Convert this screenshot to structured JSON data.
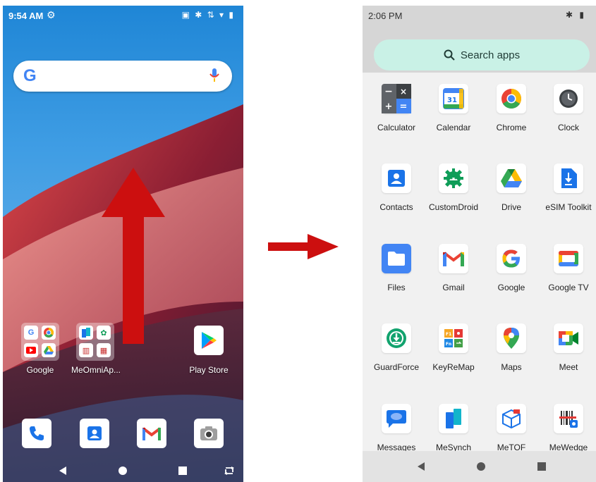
{
  "home": {
    "status_time": "9:54 AM",
    "status_icons": "▣ ✱ ⇅ ▾ ▮",
    "search_logo": "G",
    "folders": [
      {
        "label": "Google"
      },
      {
        "label": "MeOmniAp..."
      }
    ],
    "play_store_label": "Play Store",
    "dock": [
      "phone-icon",
      "contacts-icon",
      "gmail-icon",
      "camera-icon"
    ],
    "swipe_arrow_color": "#cc0f0f"
  },
  "drawer": {
    "status_time": "2:06 PM",
    "status_icons": "✱ ▮",
    "search_placeholder": "Search apps",
    "apps": [
      {
        "label": "Calculator",
        "icon": "calculator-icon"
      },
      {
        "label": "Calendar",
        "icon": "calendar-icon"
      },
      {
        "label": "Chrome",
        "icon": "chrome-icon"
      },
      {
        "label": "Clock",
        "icon": "clock-icon"
      },
      {
        "label": "Contacts",
        "icon": "contacts-icon"
      },
      {
        "label": "CustomDroid",
        "icon": "customdroid-icon"
      },
      {
        "label": "Drive",
        "icon": "drive-icon"
      },
      {
        "label": "eSIM Toolkit",
        "icon": "esim-toolkit-icon"
      },
      {
        "label": "Files",
        "icon": "files-icon"
      },
      {
        "label": "Gmail",
        "icon": "gmail-icon"
      },
      {
        "label": "Google",
        "icon": "google-icon"
      },
      {
        "label": "Google TV",
        "icon": "google-tv-icon"
      },
      {
        "label": "GuardForce",
        "icon": "guardforce-icon"
      },
      {
        "label": "KeyReMap",
        "icon": "keyremap-icon"
      },
      {
        "label": "Maps",
        "icon": "maps-icon"
      },
      {
        "label": "Meet",
        "icon": "meet-icon"
      },
      {
        "label": "Messages",
        "icon": "messages-icon"
      },
      {
        "label": "MeSynch",
        "icon": "mesynch-icon"
      },
      {
        "label": "MeTOF",
        "icon": "metof-icon"
      },
      {
        "label": "MeWedge",
        "icon": "mewedge-icon"
      }
    ],
    "calendar_day": "31"
  },
  "colors": {
    "arrow_red": "#cc0f0f",
    "search_apps_bg": "#c9f1e6",
    "drawer_bg": "#f1f1f1"
  }
}
